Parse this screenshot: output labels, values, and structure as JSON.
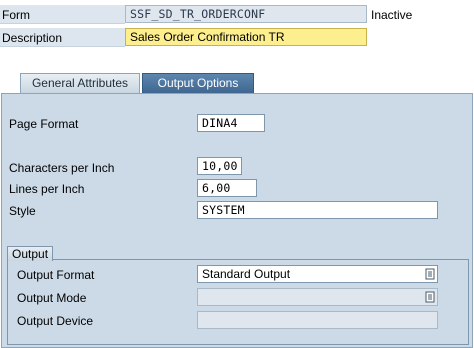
{
  "header": {
    "form_label": "Form",
    "form_value": "SSF_SD_TR_ORDERCONF",
    "status": "Inactive",
    "description_label": "Description",
    "description_value": "Sales Order Confirmation TR"
  },
  "tabs": [
    {
      "label": "General Attributes",
      "active": false
    },
    {
      "label": "Output Options",
      "active": true
    }
  ],
  "output_options": {
    "page_format_label": "Page Format",
    "page_format_value": "DINA4",
    "cpi_label": "Characters per Inch",
    "cpi_value": "10,00",
    "lpi_label": "Lines per Inch",
    "lpi_value": "6,00",
    "style_label": "Style",
    "style_value": "SYSTEM"
  },
  "output_group": {
    "title": "Output",
    "format_label": "Output Format",
    "format_value": "Standard Output",
    "mode_label": "Output Mode",
    "mode_value": "",
    "device_label": "Output Device",
    "device_value": ""
  },
  "colors": {
    "panel_bg": "#ccdae7",
    "active_tab": "#4a729b",
    "highlight_field": "#fdee8e"
  },
  "icons": {
    "f4_help": "value-help-icon"
  }
}
